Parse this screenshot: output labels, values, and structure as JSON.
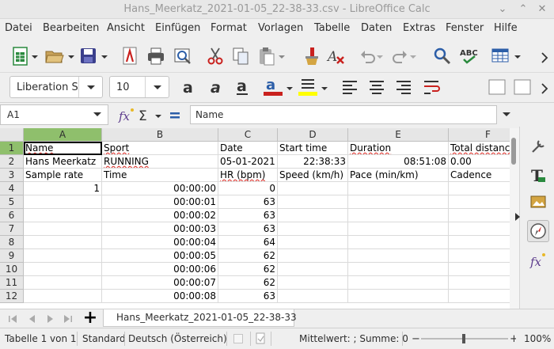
{
  "window": {
    "title": "Hans_Meerkatz_2021-01-05_22-38-33.csv - LibreOffice Calc"
  },
  "menu": [
    "Datei",
    "Bearbeiten",
    "Ansicht",
    "Einfügen",
    "Format",
    "Vorlagen",
    "Tabelle",
    "Daten",
    "Extras",
    "Fenster",
    "Hilfe"
  ],
  "toolbar": {
    "font_name": "Liberation S",
    "font_size": "10",
    "colors": {
      "font_color": "#c9211e",
      "highlight": "#ffff00",
      "accent_green": "#2a8a3e"
    }
  },
  "formula_bar": {
    "name_box": "A1",
    "content": "Name"
  },
  "columns": [
    "A",
    "B",
    "C",
    "D",
    "E",
    "F"
  ],
  "rows": [
    {
      "n": "1",
      "cells": [
        "Name",
        "Sport",
        "Date",
        "Start time",
        "Duration",
        "Total distanc"
      ]
    },
    {
      "n": "2",
      "cells": [
        "Hans Meerkatz",
        "RUNNING",
        "05-01-2021",
        "22:38:33",
        "08:51:08",
        "0.00"
      ]
    },
    {
      "n": "3",
      "cells": [
        "Sample rate",
        "Time",
        "HR (bpm)",
        "Speed (km/h)",
        "Pace (min/km)",
        "Cadence"
      ]
    },
    {
      "n": "4",
      "cells": [
        "1",
        "00:00:00",
        "0",
        "",
        "",
        ""
      ]
    },
    {
      "n": "5",
      "cells": [
        "",
        "00:00:01",
        "63",
        "",
        "",
        ""
      ]
    },
    {
      "n": "6",
      "cells": [
        "",
        "00:00:02",
        "63",
        "",
        "",
        ""
      ]
    },
    {
      "n": "7",
      "cells": [
        "",
        "00:00:03",
        "63",
        "",
        "",
        ""
      ]
    },
    {
      "n": "8",
      "cells": [
        "",
        "00:00:04",
        "64",
        "",
        "",
        ""
      ]
    },
    {
      "n": "9",
      "cells": [
        "",
        "00:00:05",
        "62",
        "",
        "",
        ""
      ]
    },
    {
      "n": "10",
      "cells": [
        "",
        "00:00:06",
        "62",
        "",
        "",
        ""
      ]
    },
    {
      "n": "11",
      "cells": [
        "",
        "00:00:07",
        "62",
        "",
        "",
        ""
      ]
    },
    {
      "n": "12",
      "cells": [
        "",
        "00:00:08",
        "63",
        "",
        "",
        ""
      ]
    }
  ],
  "sheet_tab": "Hans_Meerkatz_2021-01-05_22-38-33",
  "status": {
    "sheet": "Tabelle 1 von 1",
    "page_style": "Standard",
    "language": "Deutsch (Österreich)",
    "summary": "Mittelwert: ; Summe: 0",
    "zoom": "100%"
  }
}
